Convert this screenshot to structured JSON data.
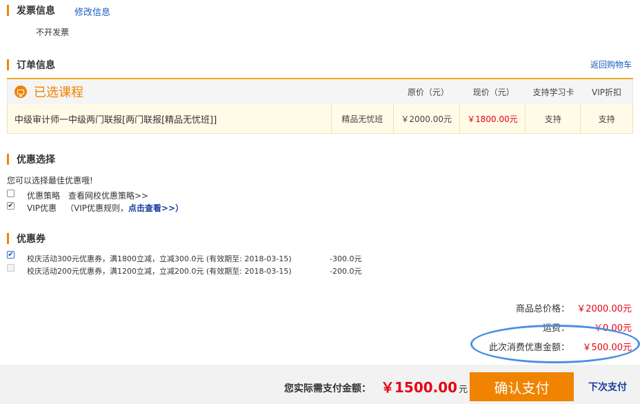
{
  "invoice": {
    "title": "发票信息",
    "edit_link": "修改信息",
    "value": "不开发票"
  },
  "order": {
    "title": "订单信息",
    "back_link": "返回购物车",
    "table": {
      "course_header": "已选课程",
      "headers": [
        "原价（元）",
        "现价（元）",
        "支持学习卡",
        "VIP折扣"
      ],
      "rows": [
        {
          "name": "中级审计师一中级两门联报[两门联报[精品无忧班]]",
          "class_type": "精品无忧班",
          "original_price": "￥2000.00元",
          "current_price": "￥1800.00元",
          "study_card": "支持",
          "vip_discount": "支持"
        }
      ]
    }
  },
  "discount": {
    "title": "优惠选择",
    "hint": "您可以选择最佳优惠哦!",
    "options": [
      {
        "label": "优惠策略",
        "link": "查看网校优惠策略>>",
        "checked": false
      },
      {
        "label": "VIP优惠",
        "sub_prefix": "（VIP优惠规则，",
        "link": "点击查看",
        "sub_suffix": ">>）",
        "checked": true
      }
    ]
  },
  "coupons": {
    "title": "优惠券",
    "items": [
      {
        "text": "校庆活动300元优惠券，满1800立减，立减300.0元 (有效期至: 2018-03-15)",
        "amount": "-300.0元",
        "checked": true,
        "disabled": false
      },
      {
        "text": "校庆活动200元优惠券，满1200立减，立减200.0元 (有效期至: 2018-03-15)",
        "amount": "-200.0元",
        "checked": false,
        "disabled": true
      }
    ]
  },
  "summary": {
    "total_label": "商品总价格：",
    "total_value": "￥2000.00元",
    "shipping_label": "运费：",
    "shipping_value": "￥0.00元",
    "discount_label": "此次消费优惠金额：",
    "discount_value": "￥500.00元"
  },
  "payment": {
    "label": "您实际需支付金额：",
    "amount": "￥1500.00",
    "unit": "元",
    "confirm_button": "确认支付",
    "next_time_link": "下次支付"
  },
  "colors": {
    "accent": "#f08300",
    "price_red": "#e60012",
    "link_blue": "#1a5cbe",
    "annotation_circle": "#4a90e2"
  }
}
